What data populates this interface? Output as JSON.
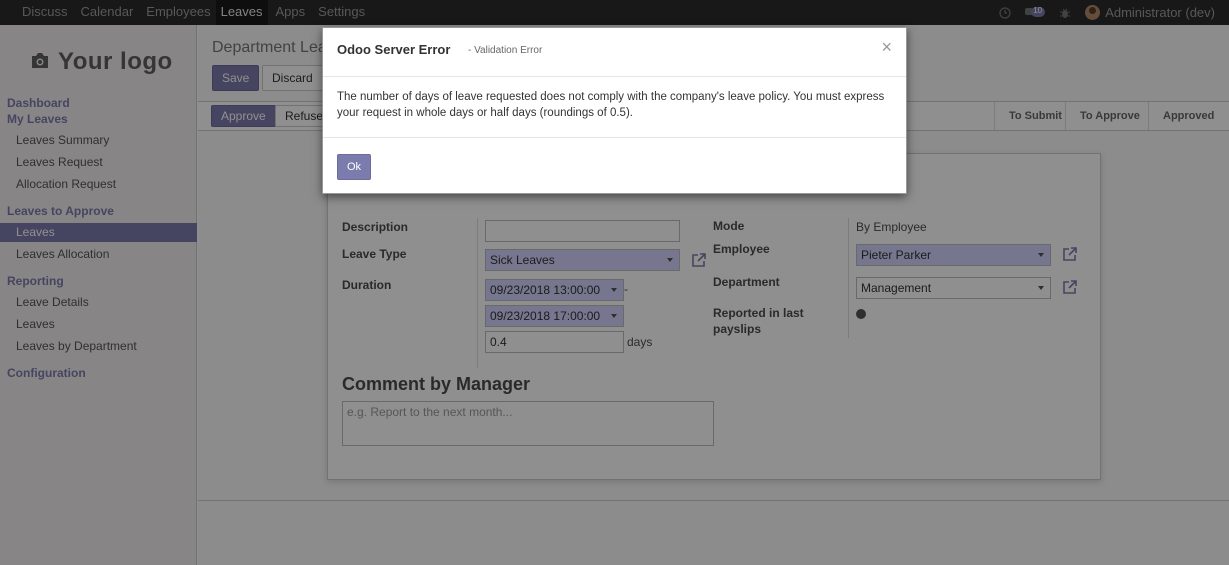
{
  "topbar": {
    "menu": [
      "Discuss",
      "Calendar",
      "Employees",
      "Leaves",
      "Apps",
      "Settings"
    ],
    "active": "Leaves",
    "messages_count": "10",
    "user": "Administrator (dev)"
  },
  "sidebar": {
    "logo": "Your logo",
    "sections": {
      "dashboard": "Dashboard",
      "my_leaves": "My Leaves",
      "leaves_summary": "Leaves Summary",
      "leaves_request": "Leaves Request",
      "allocation_request": "Allocation Request",
      "leaves_to_approve": "Leaves to Approve",
      "leaves": "Leaves",
      "leaves_allocation": "Leaves Allocation",
      "reporting": "Reporting",
      "leave_details": "Leave Details",
      "reporting_leaves": "Leaves",
      "leaves_by_department": "Leaves by Department",
      "configuration": "Configuration"
    }
  },
  "control_panel": {
    "title": "Department Lea",
    "save": "Save",
    "discard": "Discard",
    "approve": "Approve",
    "refuse": "Refuse"
  },
  "statusbar": [
    "To Submit",
    "To Approve",
    "Approved"
  ],
  "form": {
    "description_label": "Description",
    "description_value": "",
    "leave_type_label": "Leave Type",
    "leave_type_value": "Sick Leaves",
    "duration_label": "Duration",
    "date_from": "09/23/2018 13:00:00",
    "date_sep": "-",
    "date_to": "09/23/2018 17:00:00",
    "days_value": "0.4",
    "days_unit": "days",
    "mode_label": "Mode",
    "mode_value": "By Employee",
    "employee_label": "Employee",
    "employee_value": "Pieter Parker",
    "department_label": "Department",
    "department_value": "Management",
    "reported_label_1": "Reported in last",
    "reported_label_2": "payslips",
    "comment_title": "Comment by Manager",
    "comment_placeholder": "e.g. Report to the next month..."
  },
  "modal": {
    "title": "Odoo Server Error",
    "subtitle": "- Validation Error",
    "close": "×",
    "message": "The number of days of leave requested does not comply with the company's leave policy. You must express your request in whole days or half days (roundings of 0.5).",
    "ok": "Ok"
  },
  "colors": {
    "accent": "#7c7bad",
    "topbar": "#2c2c2c",
    "required": "#d2d2ff"
  }
}
